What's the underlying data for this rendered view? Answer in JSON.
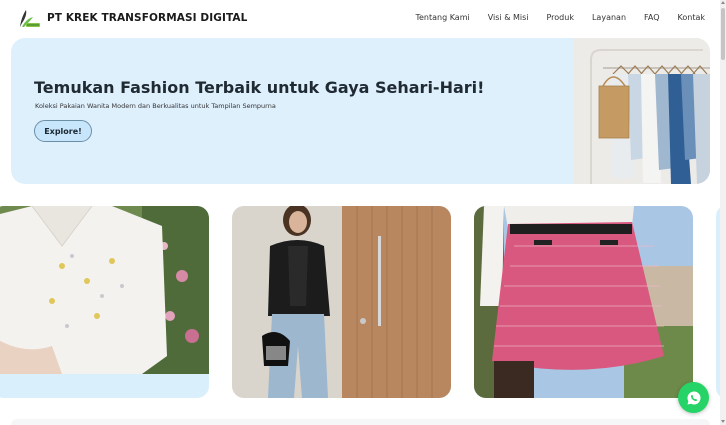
{
  "header": {
    "brand": "PT KREK TRANSFORMASI DIGITAL",
    "logo_icon": "leaf-logo-icon",
    "nav": [
      "Tentang Kami",
      "Visi & Misi",
      "Produk",
      "Layanan",
      "FAQ",
      "Kontak"
    ]
  },
  "hero": {
    "title": "Temukan Fashion Terbaik untuk Gaya Sehari-Hari!",
    "subtitle": "Koleksi Pakaian Wanita Modern dan Berkualitas untuk Tampilan Sempurna",
    "button_label": "Explore!"
  },
  "colors": {
    "hero_bg": "#dff0fd",
    "button_bg": "#c7e6fb",
    "whatsapp": "#25d366"
  },
  "products": [
    {
      "icon": "white-embroidered-blouse-image"
    },
    {
      "icon": "leather-jacket-jeans-image"
    },
    {
      "icon": "tweed-skirt-image"
    }
  ],
  "whatsapp_icon": "whatsapp-icon"
}
